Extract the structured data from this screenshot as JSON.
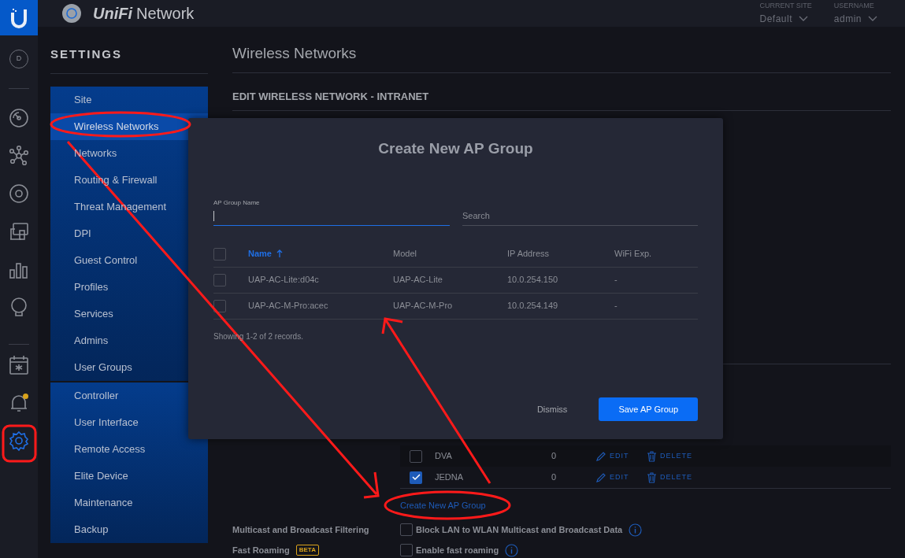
{
  "top_bar": {
    "brand": "UniFi",
    "product": "Network",
    "current_site": {
      "label": "CURRENT SITE",
      "value": "Default"
    },
    "username": {
      "label": "USERNAME",
      "value": "admin"
    }
  },
  "rail": {
    "site_badge": "D",
    "items": [
      {
        "kind": "dashboard",
        "selected": false,
        "notification": false
      },
      {
        "kind": "topology",
        "selected": false,
        "notification": false
      },
      {
        "kind": "devices",
        "selected": false,
        "notification": false
      },
      {
        "kind": "clients",
        "selected": false,
        "notification": false
      },
      {
        "kind": "statistics",
        "selected": false,
        "notification": false
      },
      {
        "kind": "insights",
        "selected": false,
        "notification": false
      },
      {
        "kind": "events",
        "selected": false,
        "notification": false
      },
      {
        "kind": "alerts",
        "selected": false,
        "notification": true
      },
      {
        "kind": "settings",
        "selected": true,
        "notification": false
      }
    ]
  },
  "sidebar": {
    "title": "SETTINGS",
    "groups": [
      {
        "items": [
          {
            "label": "Site",
            "selected": false
          },
          {
            "label": "Wireless Networks",
            "selected": true
          },
          {
            "label": "Networks",
            "selected": false
          },
          {
            "label": "Routing & Firewall",
            "selected": false
          },
          {
            "label": "Threat Management",
            "selected": false
          },
          {
            "label": "DPI",
            "selected": false
          },
          {
            "label": "Guest Control",
            "selected": false
          },
          {
            "label": "Profiles",
            "selected": false
          },
          {
            "label": "Services",
            "selected": false
          },
          {
            "label": "Admins",
            "selected": false
          },
          {
            "label": "User Groups",
            "selected": false
          }
        ]
      },
      {
        "items": [
          {
            "label": "Controller",
            "selected": false
          },
          {
            "label": "User Interface",
            "selected": false
          },
          {
            "label": "Remote Access",
            "selected": false
          },
          {
            "label": "Elite Device",
            "selected": false
          },
          {
            "label": "Maintenance",
            "selected": false
          },
          {
            "label": "Backup",
            "selected": false
          }
        ]
      }
    ]
  },
  "main": {
    "title": "Wireless Networks",
    "subtitle": "EDIT WIRELESS NETWORK - INTRANET",
    "ap_groups": [
      {
        "name": "DVA",
        "count": "0",
        "checked": false,
        "edit": "EDIT",
        "delete": "DELETE"
      },
      {
        "name": "JEDNA",
        "count": "0",
        "checked": true,
        "edit": "EDIT",
        "delete": "DELETE"
      }
    ],
    "create_link": "Create New AP Group",
    "options": [
      {
        "label": "Multicast and Broadcast Filtering",
        "checkbox_label": "Block LAN to WLAN Multicast and Broadcast Data",
        "checked": false
      },
      {
        "label": "Fast Roaming",
        "badge": "BETA",
        "checkbox_label": "Enable fast roaming",
        "checked": false
      }
    ]
  },
  "modal": {
    "title": "Create New AP Group",
    "all_checked": false,
    "name_field": {
      "label": "AP Group Name"
    },
    "search": {
      "placeholder": "Search"
    },
    "columns": [
      {
        "label": "Name",
        "sorted": true
      },
      {
        "label": "Model",
        "sorted": false
      },
      {
        "label": "IP Address",
        "sorted": false
      },
      {
        "label": "WiFi Exp.",
        "sorted": false
      }
    ],
    "rows": [
      {
        "checked": false,
        "cells": [
          "UAP-AC-Lite:d04c",
          "UAP-AC-Lite",
          "10.0.254.150",
          "-"
        ]
      },
      {
        "checked": false,
        "cells": [
          "UAP-AC-M-Pro:acec",
          "UAP-AC-M-Pro",
          "10.0.254.149",
          "-"
        ]
      }
    ],
    "footer": "Showing 1-2 of 2 records.",
    "buttons": [
      {
        "kind": "secondary",
        "label": "Dismiss"
      },
      {
        "kind": "primary",
        "label": "Save AP Group"
      }
    ]
  }
}
